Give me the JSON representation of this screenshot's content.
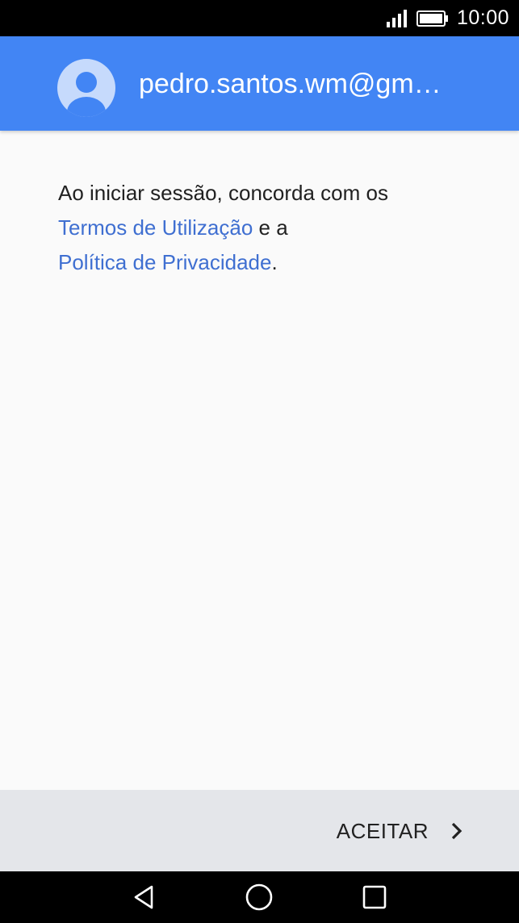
{
  "status_bar": {
    "time": "10:00",
    "signal_icon": "signal-bars-icon",
    "battery_icon": "battery-icon"
  },
  "account": {
    "email": "pedro.santos.wm@gm…",
    "avatar_icon": "person-avatar-icon"
  },
  "terms": {
    "line1": "Ao iniciar sessão, concorda com os",
    "terms_link": "Termos de Utilização",
    "connector": " e a",
    "privacy_link": "Política de Privacidade",
    "period": "."
  },
  "actions": {
    "accept_label": "ACEITAR",
    "accept_icon": "chevron-right-icon"
  },
  "nav_bar": {
    "back_icon": "back-triangle-icon",
    "home_icon": "home-circle-icon",
    "recents_icon": "recents-square-icon"
  },
  "colors": {
    "header_blue": "#4285f4",
    "link_blue": "#3f6fd1",
    "action_bar_gray": "#e4e6ea",
    "background": "#fafafa"
  }
}
